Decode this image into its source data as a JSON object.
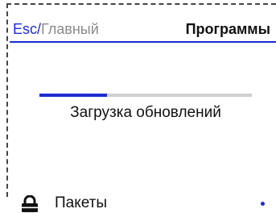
{
  "breadcrumb": {
    "esc": "Esc",
    "separator": "/",
    "main": "Главный"
  },
  "header": {
    "title": "Программы"
  },
  "update": {
    "label": "Загрузка обновлений",
    "progress_fraction": 0.32
  },
  "menu": {
    "items": [
      {
        "label": "Пакеты",
        "icon": "lock-icon",
        "selected": true
      }
    ]
  },
  "colors": {
    "accent": "#1c2bd1",
    "muted_text": "#8a8a8a",
    "track": "#cfcfcf",
    "frame": "#444444"
  }
}
